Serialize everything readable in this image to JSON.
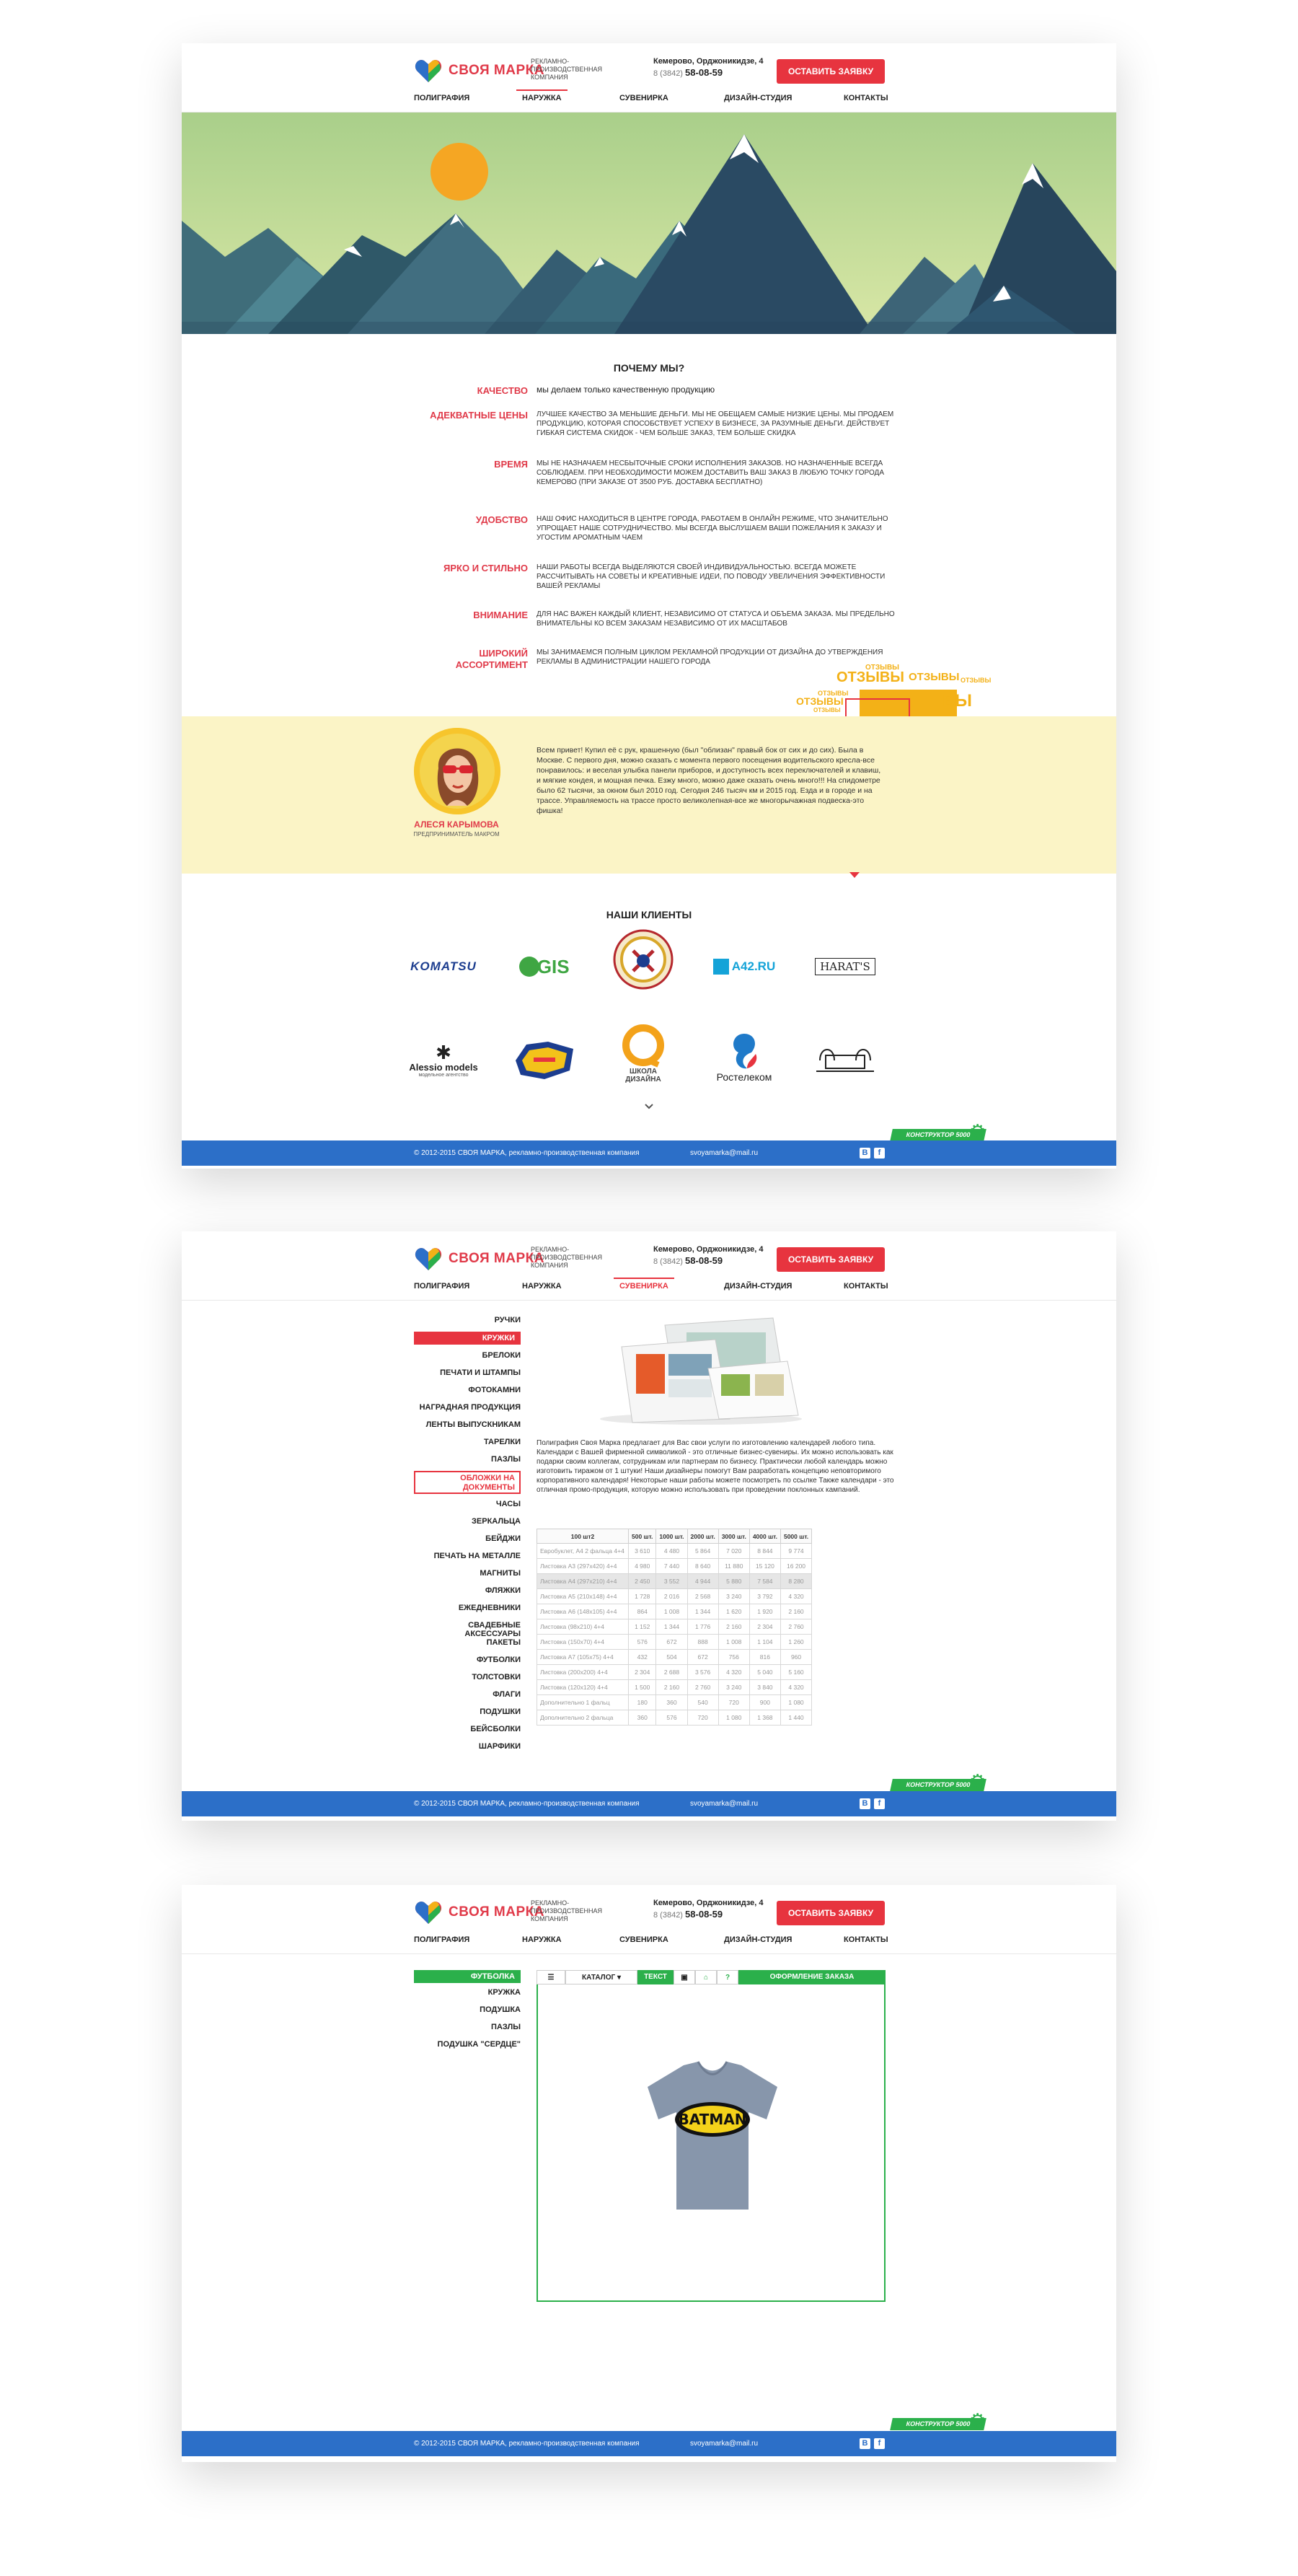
{
  "brand": {
    "name": "СВОЯ МАРКА",
    "subtitle": "РЕКЛАМНО-ПРОИЗВОДСТВЕННАЯ КОМПАНИЯ",
    "address": "Кемерово, Орджоникидзе, 4",
    "phone_prefix": "8 (3842)",
    "phone": "58-08-59",
    "order_button": "ОСТАВИТЬ ЗАЯВКУ",
    "colors": {
      "accent": "#e7343f",
      "footer": "#2c6fc8",
      "green": "#2bb04b",
      "testimonial_bg": "#fbf4c6"
    }
  },
  "nav": [
    "ПОЛИГРАФИЯ",
    "НАРУЖКА",
    "СУВЕНИРКА",
    "ДИЗАЙН-СТУДИЯ",
    "КОНТАКТЫ"
  ],
  "why": {
    "title": "ПОЧЕМУ МЫ?",
    "items": [
      {
        "label": "КАЧЕСТВО",
        "text": "мы делаем только качественную продукцию"
      },
      {
        "label": "АДЕКВАТНЫЕ ЦЕНЫ",
        "text": "ЛУЧШЕЕ КАЧЕСТВО ЗА МЕНЬШИЕ ДЕНЬГИ. МЫ НЕ ОБЕЩАЕМ САМЫЕ НИЗКИЕ ЦЕНЫ. МЫ ПРОДАЕМ ПРОДУКЦИЮ, КОТОРАЯ СПОСОБСТВУЕТ УСПЕХУ В БИЗНЕСЕ, ЗА РАЗУМНЫЕ ДЕНЬГИ. ДЕЙСТВУЕТ ГИБКАЯ СИСТЕМА СКИДОК - ЧЕМ БОЛЬШЕ ЗАКАЗ, ТЕМ БОЛЬШЕ СКИДКА"
      },
      {
        "label": "ВРЕМЯ",
        "text": "МЫ НЕ НАЗНАЧАЕМ НЕСБЫТОЧНЫЕ СРОКИ ИСПОЛНЕНИЯ ЗАКАЗОВ. НО НАЗНАЧЕННЫЕ ВСЕГДА СОБЛЮДАЕМ. ПРИ НЕОБХОДИМОСТИ МОЖЕМ ДОСТАВИТЬ ВАШ ЗАКАЗ В ЛЮБУЮ ТОЧКУ ГОРОДА КЕМЕРОВО (ПРИ ЗАКАЗЕ ОТ 3500 РУБ. ДОСТАВКА БЕСПЛАТНО)"
      },
      {
        "label": "УДОБСТВО",
        "text": "НАШ ОФИС НАХОДИТЬСЯ В ЦЕНТРЕ ГОРОДА, РАБОТАЕМ В ОНЛАЙН РЕЖИМЕ, ЧТО ЗНАЧИТЕЛЬНО УПРОЩАЕТ НАШЕ СОТРУДНИЧЕСТВО. МЫ ВСЕГДА ВЫСЛУШАЕМ ВАШИ ПОЖЕЛАНИЯ К ЗАКАЗУ И УГОСТИМ АРОМАТНЫМ ЧАЕМ"
      },
      {
        "label": "ЯРКО И СТИЛЬНО",
        "text": "НАШИ РАБОТЫ ВСЕГДА ВЫДЕЛЯЮТСЯ СВОЕЙ ИНДИВИДУАЛЬНОСТЬЮ. ВСЕГДА МОЖЕТЕ РАССЧИТЫВАТЬ НА СОВЕТЫ И КРЕАТИВНЫЕ ИДЕИ, ПО ПОВОДУ УВЕЛИЧЕНИЯ ЭФФЕКТИВНОСТИ ВАШЕЙ РЕКЛАМЫ"
      },
      {
        "label": "ВНИМАНИЕ",
        "text": "ДЛЯ НАС ВАЖЕН КАЖДЫЙ КЛИЕНТ, НЕЗАВИСИМО ОТ СТАТУСА И ОБЪЕМА ЗАКАЗА. МЫ ПРЕДЕЛЬНО ВНИМАТЕЛЬНЫ КО ВСЕМ ЗАКАЗАМ НЕЗАВИСИМО ОТ ИХ МАСШТАБОВ"
      },
      {
        "label": "ШИРОКИЙ АССОРТИМЕНТ",
        "text": "МЫ ЗАНИМАЕМСЯ ПОЛНЫМ ЦИКЛОМ РЕКЛАМНОЙ ПРОДУКЦИИ ОТ ДИЗАЙНА ДО УТВЕРЖДЕНИЯ РЕКЛАМЫ В АДМИНИСТРАЦИИ НАШЕГО ГОРОДА"
      }
    ]
  },
  "reviews_cloud": {
    "word": "ОТЗЫВЫ",
    "word_part": "ВЫ"
  },
  "testimonial": {
    "name": "АЛЕСЯ КАРЫМОВА",
    "role": "ПРЕДПРИНИМАТЕЛЬ МАКРОМ",
    "text": "Всем привет! Купил её с рук, крашенную (был \"облизан\" правый бок от сих и до сих). Была в Москве. С первого дня, можно сказать с момента первого посещения водительского кресла-все понравилось: и веселая улыбка панели приборов, и доступность всех переключателей и клавиш, и мягкие кондея, и мощная печка. Езжу много, можно даже сказать очень много!!! На спидометре было 62 тысячи, за окном был 2010 год. Сегодня 246 тысяч км и 2015 год. Езда и в городе и на трассе. Управляемость на трассе просто великолепная-все же многорычажная подвеска-это фишка!"
  },
  "clients": {
    "title": "НАШИ КЛИЕНТЫ",
    "logos": [
      "KOMATSU",
      "2GIS",
      "",
      "A42.RU",
      "HARAT'S",
      "Alessio models",
      "",
      "ШКОЛА ДИЗАЙНА",
      "Ростелеком",
      "PUB"
    ],
    "sublines": {
      "alessio": "модельное агентство"
    }
  },
  "footer": {
    "copyright": "© 2012-2015 СВОЯ МАРКА, рекламно-производственная компания",
    "email": "svoyamarka@mail.ru",
    "constructor": "КОНСТРУКТОР 5000"
  },
  "souvenirs": {
    "menu": [
      "РУЧКИ",
      "КРУЖКИ",
      "БРЕЛОКИ",
      "ПЕЧАТИ И ШТАМПЫ",
      "ФОТОКАМНИ",
      "НАГРАДНАЯ ПРОДУКЦИЯ",
      "ЛЕНТЫ ВЫПУСКНИКАМ",
      "ТАРЕЛКИ",
      "ПАЗЛЫ",
      "ОБЛОЖКИ НА ДОКУМЕНТЫ",
      "ЧАСЫ",
      "ЗЕРКАЛЬЦА",
      "БЕЙДЖИ",
      "ПЕЧАТЬ НА МЕТАЛЛЕ",
      "МАГНИТЫ",
      "ФЛЯЖКИ",
      "ЕЖЕДНЕВНИКИ",
      "СВАДЕБНЫЕ АКСЕССУАРЫ",
      "ПАКЕТЫ",
      "ФУТБОЛКИ",
      "ТОЛСТОВКИ",
      "ФЛАГИ",
      "ПОДУШКИ",
      "БЕЙСБОЛКИ",
      "ШАРФИКИ"
    ],
    "active_index": 1,
    "outlined_index": 9,
    "intro": "Полиграфия Своя Марка предлагает для Вас свои услуги по изготовлению календарей любого типа. Календари с Вашей фирменной символикой - это отличные бизнес-сувениры. Их можно использовать как подарки своим коллегам, сотрудникам или партнерам по бизнесу. Практически любой календарь можно изготовить тиражом от 1 штуки! Наши дизайнеры помогут Вам разработать концепцию неповторимого корпоративного календаря! Некоторые наши работы можете посмотреть по ссылке Также календари - это отличная промо-продукция, которую можно использовать при проведении поклонных кампаний.",
    "table": {
      "headers": [
        "100 шт2",
        "500 шт.",
        "1000 шт.",
        "2000 шт.",
        "3000 шт.",
        "4000 шт.",
        "5000 шт."
      ],
      "rows": [
        [
          "Евробуклет, А4 2 фальца 4+4",
          "3 610",
          "4 480",
          "5 864",
          "7 020",
          "8 844",
          "9 774"
        ],
        [
          "Листовка А3 (297x420) 4+4",
          "4 980",
          "7 440",
          "8 640",
          "11 880",
          "15 120",
          "16 200"
        ],
        [
          "Листовка А4 (297x210) 4+4",
          "2 450",
          "3 552",
          "4 944",
          "5 880",
          "7 584",
          "8 280"
        ],
        [
          "Листовка А5 (210x148) 4+4",
          "1 728",
          "2 016",
          "2 568",
          "3 240",
          "3 792",
          "4 320"
        ],
        [
          "Листовка А6 (148x105) 4+4",
          "864",
          "1 008",
          "1 344",
          "1 620",
          "1 920",
          "2 160"
        ],
        [
          "Листовка (98x210) 4+4",
          "1 152",
          "1 344",
          "1 776",
          "2 160",
          "2 304",
          "2 760"
        ],
        [
          "Листовка (150x70) 4+4",
          "576",
          "672",
          "888",
          "1 008",
          "1 104",
          "1 260"
        ],
        [
          "Листовка А7 (105x75) 4+4",
          "432",
          "504",
          "672",
          "756",
          "816",
          "960"
        ],
        [
          "Листовка (200x200) 4+4",
          "2 304",
          "2 688",
          "3 576",
          "4 320",
          "5 040",
          "5 160"
        ],
        [
          "Листовка (120x120) 4+4",
          "1 500",
          "2 160",
          "2 760",
          "3 240",
          "3 840",
          "4 320"
        ],
        [
          "Дополнительно 1 фальц",
          "180",
          "360",
          "540",
          "720",
          "900",
          "1 080"
        ],
        [
          "Дополнительно 2 фальца",
          "360",
          "576",
          "720",
          "1 080",
          "1 368",
          "1 440"
        ]
      ],
      "highlight_row": 2
    }
  },
  "constructor_page": {
    "menu": [
      "ФУТБОЛКА",
      "КРУЖКА",
      "ПОДУШКА",
      "ПАЗЛЫ",
      "ПОДУШКА \"СЕРДЦЕ\""
    ],
    "active_index": 0,
    "toolbar": {
      "menu_icon": "hamburger-icon",
      "catalog": "КАТАЛОГ",
      "text": "ТЕКСТ",
      "order": "ОФОРМЛЕНИЕ ЗАКАЗА"
    },
    "product_print": "BATMAN"
  }
}
